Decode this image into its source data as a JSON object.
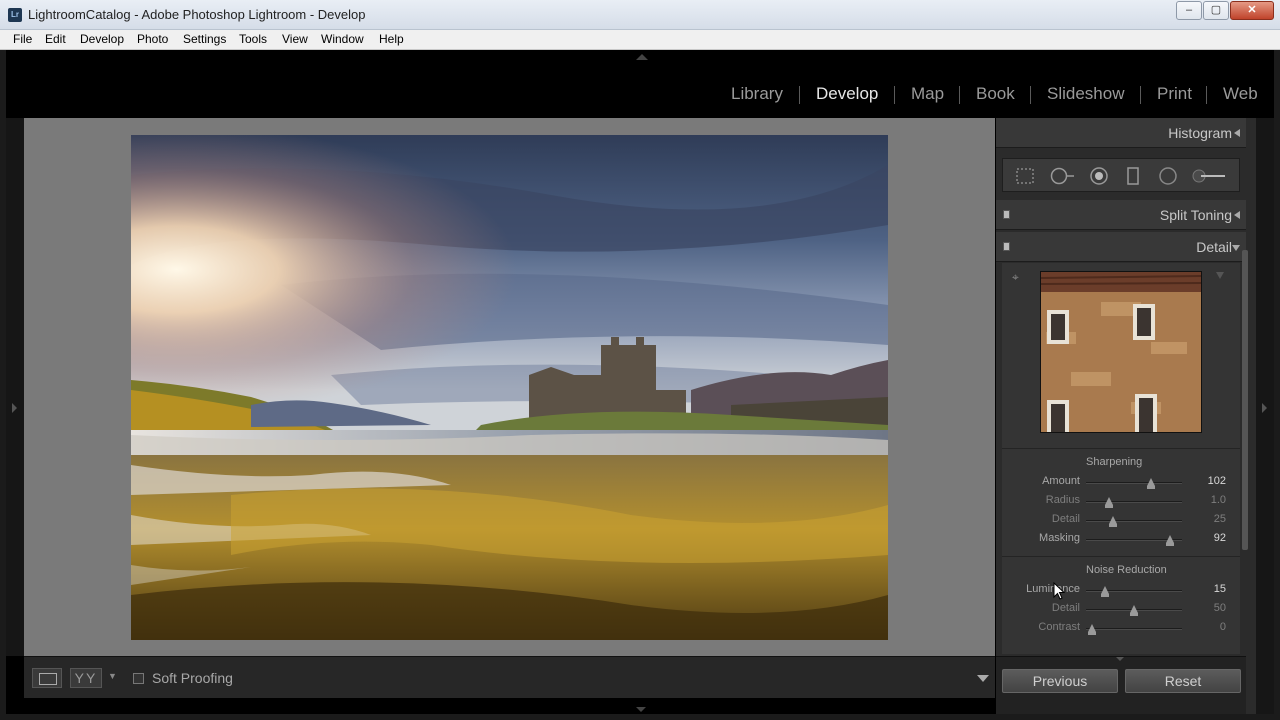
{
  "window": {
    "title": "LightroomCatalog - Adobe Photoshop Lightroom - Develop",
    "app_icon": "Lr",
    "buttons": {
      "minimize": "–",
      "maximize": "▢",
      "close": "✕"
    }
  },
  "menu": [
    "File",
    "Edit",
    "Develop",
    "Photo",
    "Settings",
    "Tools",
    "View",
    "Window",
    "Help"
  ],
  "modules": [
    {
      "label": "Library",
      "active": false
    },
    {
      "label": "Develop",
      "active": true
    },
    {
      "label": "Map",
      "active": false
    },
    {
      "label": "Book",
      "active": false
    },
    {
      "label": "Slideshow",
      "active": false
    },
    {
      "label": "Print",
      "active": false
    },
    {
      "label": "Web",
      "active": false
    }
  ],
  "right_panel": {
    "histogram": {
      "title": "Histogram"
    },
    "tools": [
      "crop-overlay-icon",
      "spot-removal-icon",
      "red-eye-icon",
      "graduated-filter-icon",
      "radial-filter-icon",
      "adjustment-brush-icon"
    ],
    "split_toning": {
      "title": "Split Toning"
    },
    "detail": {
      "title": "Detail",
      "sharpening": {
        "title": "Sharpening",
        "sliders": [
          {
            "label": "Amount",
            "value": "102",
            "fraction": 0.68,
            "dim": false
          },
          {
            "label": "Radius",
            "value": "1.0",
            "fraction": 0.24,
            "dim": true
          },
          {
            "label": "Detail",
            "value": "25",
            "fraction": 0.28,
            "dim": true
          },
          {
            "label": "Masking",
            "value": "92",
            "fraction": 0.87,
            "dim": false
          }
        ]
      },
      "noise_reduction": {
        "title": "Noise Reduction",
        "sliders": [
          {
            "label": "Luminance",
            "value": "15",
            "fraction": 0.2,
            "dim": false
          },
          {
            "label": "Detail",
            "value": "50",
            "fraction": 0.5,
            "dim": true
          },
          {
            "label": "Contrast",
            "value": "0",
            "fraction": 0.06,
            "dim": true
          }
        ]
      }
    },
    "buttons": {
      "previous": "Previous",
      "reset": "Reset"
    }
  },
  "toolbar": {
    "view_mode": "YY",
    "soft_proofing": "Soft Proofing",
    "soft_proofing_checked": false
  },
  "colors": {
    "active_module": "#e6e6e6",
    "inactive_module": "#9a9a9a",
    "canvas_background": "#7a7a7a",
    "panel_background": "#2b2b2b"
  }
}
